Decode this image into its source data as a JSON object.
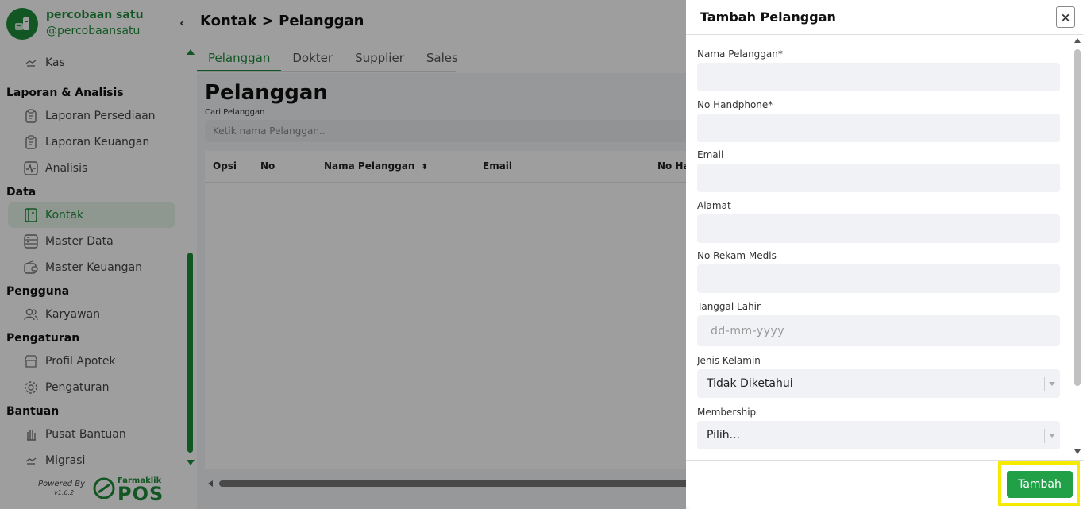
{
  "brand": {
    "name": "percobaan satu",
    "handle": "@percobaansatu"
  },
  "sidebar": {
    "sections": [
      {
        "title": "",
        "items": [
          {
            "label": "Kas",
            "icon": "cash-icon"
          }
        ]
      },
      {
        "title": "Laporan & Analisis",
        "items": [
          {
            "label": "Laporan Persediaan",
            "icon": "clipboard-icon"
          },
          {
            "label": "Laporan Keuangan",
            "icon": "clipboard-icon"
          },
          {
            "label": "Analisis",
            "icon": "activity-icon"
          }
        ]
      },
      {
        "title": "Data",
        "items": [
          {
            "label": "Kontak",
            "icon": "contact-book-icon",
            "active": true
          },
          {
            "label": "Master Data",
            "icon": "database-icon"
          },
          {
            "label": "Master Keuangan",
            "icon": "wallet-icon"
          }
        ]
      },
      {
        "title": "Pengguna",
        "items": [
          {
            "label": "Karyawan",
            "icon": "users-icon"
          }
        ]
      },
      {
        "title": "Pengaturan",
        "items": [
          {
            "label": "Profil Apotek",
            "icon": "store-icon"
          },
          {
            "label": "Pengaturan",
            "icon": "gear-icon"
          }
        ]
      },
      {
        "title": "Bantuan",
        "items": [
          {
            "label": "Pusat Bantuan",
            "icon": "hand-icon"
          },
          {
            "label": "Migrasi",
            "icon": "migrate-icon"
          }
        ]
      }
    ]
  },
  "footer": {
    "powered": "Powered By",
    "version": "v1.6.2",
    "logo_brand": "Farmaklik",
    "logo_text": "POS"
  },
  "main": {
    "breadcrumb": "Kontak > Pelanggan",
    "tabs": [
      "Pelanggan",
      "Dokter",
      "Supplier",
      "Sales"
    ],
    "active_tab": "Pelanggan",
    "page_title": "Pelanggan",
    "search": {
      "label": "Cari Pelanggan",
      "placeholder": "Ketik nama Pelanggan.."
    },
    "table_columns": [
      "Opsi",
      "No",
      "Nama Pelanggan",
      "Email",
      "No Ha"
    ]
  },
  "drawer": {
    "title": "Tambah Pelanggan",
    "close": "×",
    "fields": {
      "nama": "Nama Pelanggan*",
      "hp": "No Handphone*",
      "email": "Email",
      "alamat": "Alamat",
      "rekam": "No Rekam Medis",
      "tanggal": "Tanggal Lahir",
      "tanggal_placeholder": "dd-mm-yyyy",
      "kelamin": "Jenis Kelamin",
      "kelamin_value": "Tidak Diketahui",
      "membership": "Membership",
      "membership_value": "Pilih..."
    },
    "submit": "Tambah"
  },
  "colors": {
    "accent": "#1e8c3a",
    "button": "#22a048",
    "highlight": "#f5ea00"
  }
}
